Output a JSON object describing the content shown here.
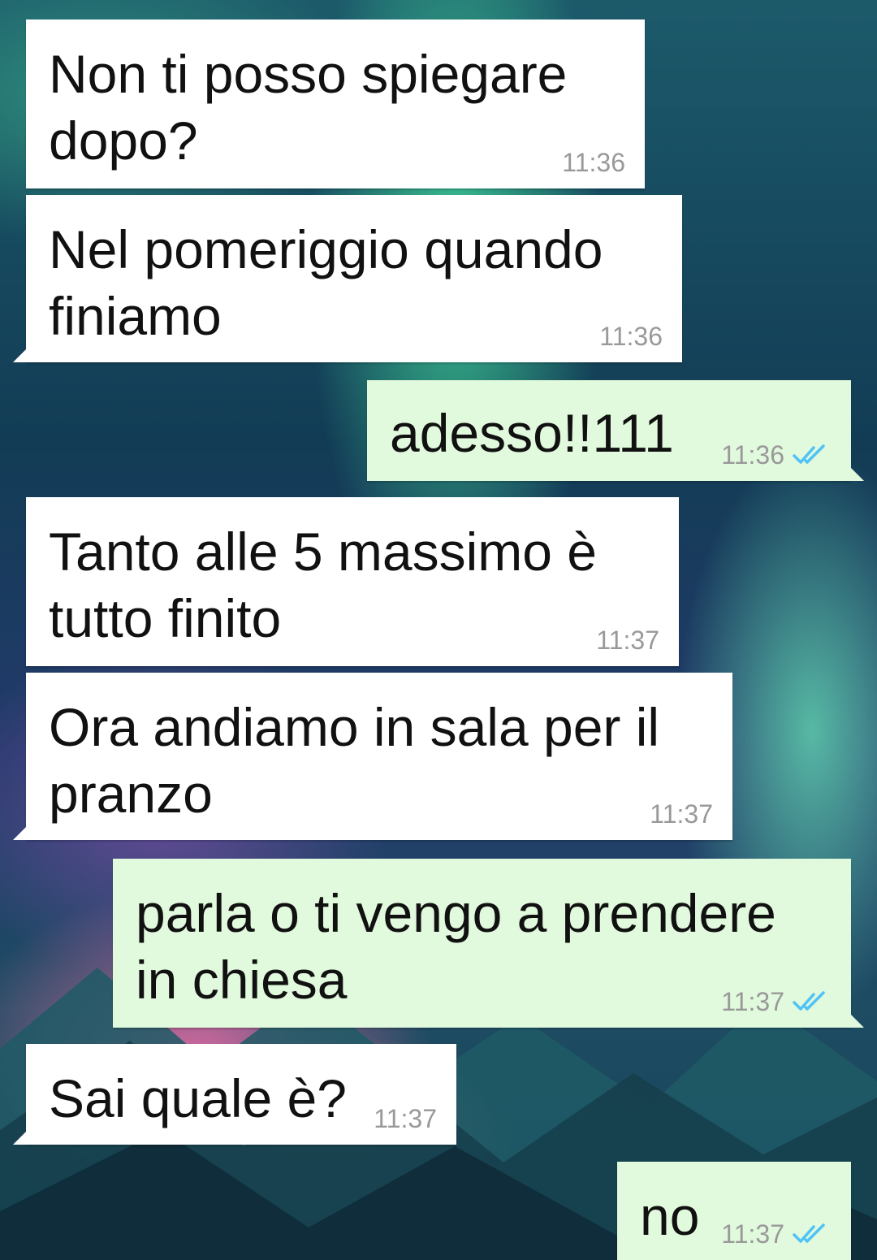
{
  "messages": [
    {
      "direction": "in",
      "text": "Non ti posso spiegare\ndopo?",
      "time": "11:36"
    },
    {
      "direction": "in",
      "text": "Nel pomeriggio quando\nfiniamo",
      "time": "11:36"
    },
    {
      "direction": "out",
      "text": "adesso!!111",
      "time": "11:36",
      "status": "double-check-icon"
    },
    {
      "direction": "in",
      "text": "Tanto alle 5 massimo è\ntutto finito",
      "time": "11:37"
    },
    {
      "direction": "in",
      "text": "Ora andiamo in sala per il\npranzo",
      "time": "11:37"
    },
    {
      "direction": "out",
      "text": "parla o ti vengo a prendere\nin chiesa",
      "time": "11:37",
      "status": "double-check-icon"
    },
    {
      "direction": "in",
      "text": "Sai quale è?",
      "time": "11:37"
    },
    {
      "direction": "out",
      "text": "no",
      "time": "11:37",
      "status": "double-check-icon"
    }
  ],
  "colors": {
    "incoming_bubble": "#ffffff",
    "outgoing_bubble": "#e1f9dc",
    "timestamp": "#999999",
    "read_check": "#4fc3f7"
  }
}
